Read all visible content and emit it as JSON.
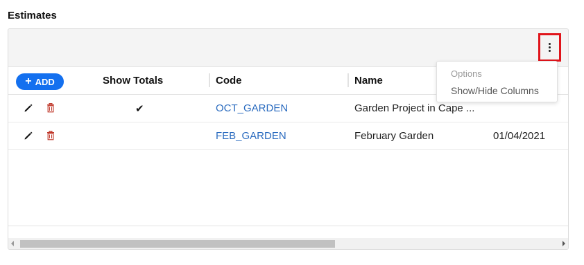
{
  "section": {
    "title": "Estimates"
  },
  "toolbar": {
    "menu_icon": "vertical-dots-icon",
    "highlight_color": "#e0141b"
  },
  "table": {
    "add_label": "ADD",
    "columns": {
      "show_totals": "Show Totals",
      "code": "Code",
      "name": "Name"
    },
    "rows": [
      {
        "show_totals": "✔",
        "code": "OCT_GARDEN",
        "name": "Garden Project in Cape ...",
        "date": ""
      },
      {
        "show_totals": "",
        "code": "FEB_GARDEN",
        "name": "February Garden",
        "date": "01/04/2021"
      }
    ]
  },
  "options_menu": {
    "title": "Options",
    "items": [
      "Show/Hide Columns"
    ]
  },
  "colors": {
    "accent": "#1470ef",
    "link": "#2a6bbf",
    "delete": "#c0392b"
  }
}
